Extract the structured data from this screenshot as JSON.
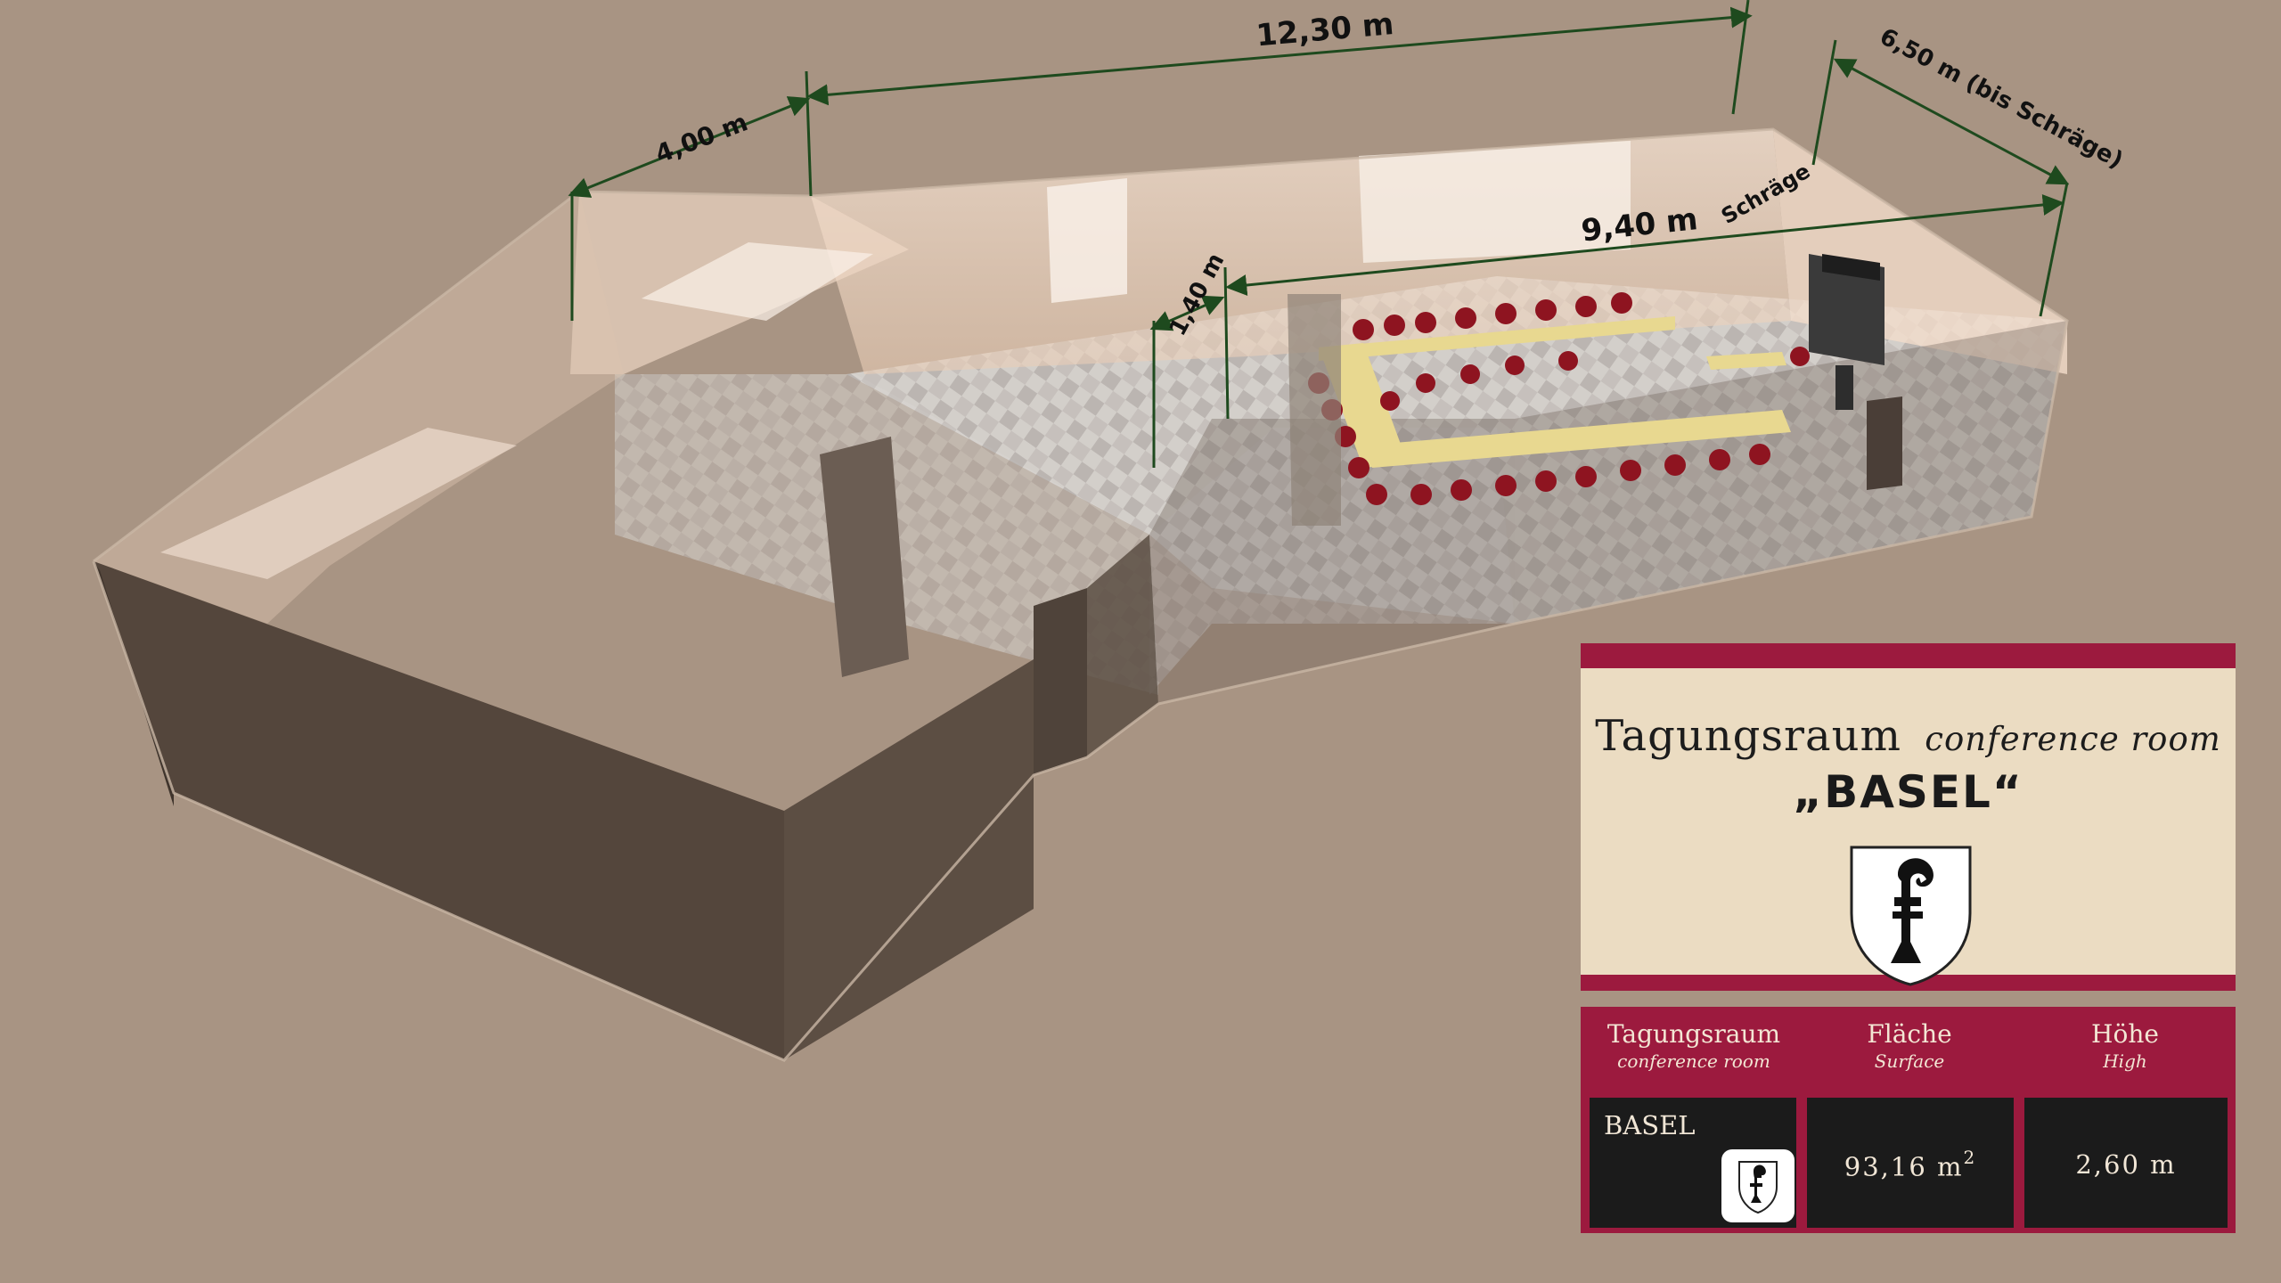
{
  "dimensions": {
    "length_top": "12,30 m",
    "width_left": "4,00 m",
    "width_right": "6,50 m (bis Schräge)",
    "length_inner": "9,40 m",
    "bevel_label": "Schräge",
    "offset": "1,40 m"
  },
  "card": {
    "title_de": "Tagungsraum",
    "title_en": "conference room",
    "name": "„BASEL“"
  },
  "table": {
    "headers": [
      {
        "main": "Tagungsraum",
        "sub": "conference room"
      },
      {
        "main": "Fläche",
        "sub": "Surface"
      },
      {
        "main": "Höhe",
        "sub": "High"
      }
    ],
    "row": {
      "name": "BASEL",
      "surface_value": "93,16 m",
      "surface_unit_sup": "2",
      "height": "2,60 m"
    }
  },
  "colors": {
    "background": "#a89483",
    "accent": "#9c1a3e",
    "card_fill": "#ebdcc2",
    "cell_fill": "#1b1b1b",
    "dimension_line": "#1e4a1e",
    "chair": "#8e1420",
    "table_top": "#e8d890"
  },
  "icons": [
    "basel-crest-icon",
    "basel-crest-small-icon"
  ]
}
